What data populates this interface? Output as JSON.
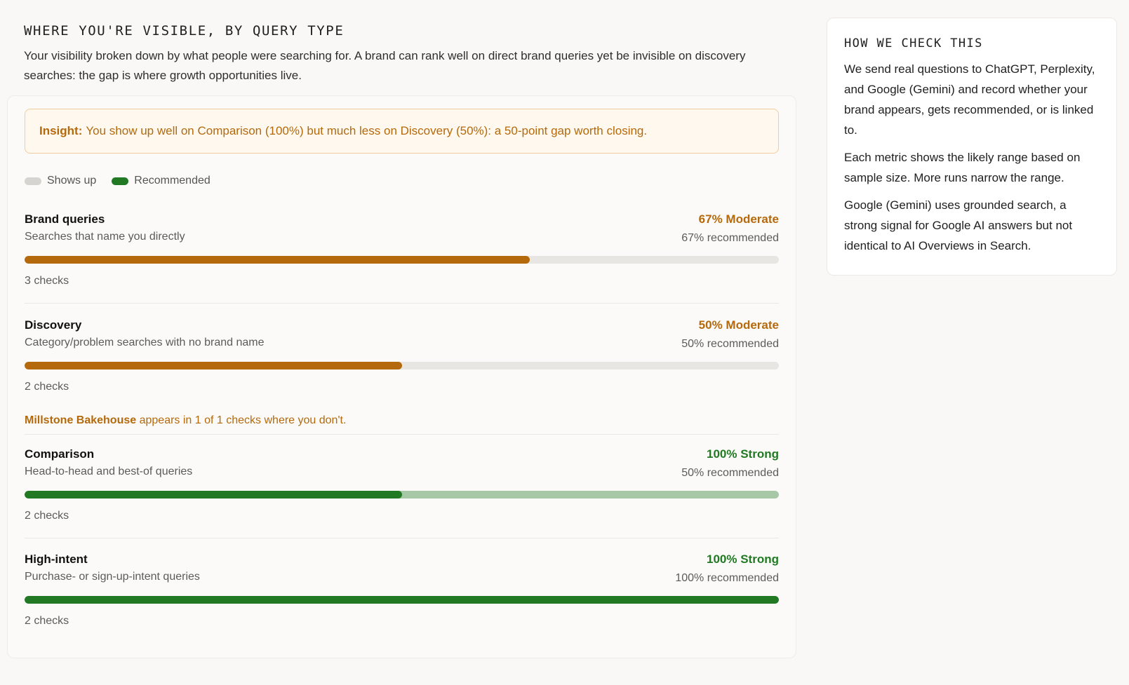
{
  "header": {
    "title": "WHERE YOU'RE VISIBLE, BY QUERY TYPE",
    "description": "Your visibility broken down by what people were searching for. A brand can rank well on direct brand queries yet be invisible on discovery searches: the gap is where growth opportunities live."
  },
  "insight": {
    "label": "Insight:",
    "text": "You show up well on Comparison (100%) but much less on Discovery (50%): a 50-point gap worth closing."
  },
  "legend": {
    "shows_up": "Shows up",
    "recommended": "Recommended"
  },
  "colors": {
    "moderate": "#b46a0c",
    "strong": "#217a23",
    "strong_light": "#a6c8a6",
    "track": "#e8e6e3"
  },
  "query_types": [
    {
      "name": "Brand queries",
      "subtitle": "Searches that name you directly",
      "score_label": "67% Moderate",
      "level": "moderate",
      "shows_up_pct": 67,
      "recommended_pct": 67,
      "recommended_label": "67% recommended",
      "checks_label": "3 checks"
    },
    {
      "name": "Discovery",
      "subtitle": "Category/problem searches with no brand name",
      "score_label": "50% Moderate",
      "level": "moderate",
      "shows_up_pct": 50,
      "recommended_pct": 50,
      "recommended_label": "50% recommended",
      "checks_label": "2 checks",
      "competitor": {
        "name": "Millstone Bakehouse",
        "text": "appears in 1 of 1 checks where you don't."
      }
    },
    {
      "name": "Comparison",
      "subtitle": "Head-to-head and best-of queries",
      "score_label": "100% Strong",
      "level": "strong",
      "shows_up_pct": 100,
      "recommended_pct": 50,
      "recommended_label": "50% recommended",
      "checks_label": "2 checks"
    },
    {
      "name": "High-intent",
      "subtitle": "Purchase- or sign-up-intent queries",
      "score_label": "100% Strong",
      "level": "strong",
      "shows_up_pct": 100,
      "recommended_pct": 100,
      "recommended_label": "100% recommended",
      "checks_label": "2 checks"
    }
  ],
  "sidebar": {
    "title": "HOW WE CHECK THIS",
    "paragraphs": [
      "We send real questions to ChatGPT, Perplexity, and Google (Gemini) and record whether your brand appears, gets recommended, or is linked to.",
      "Each metric shows the likely range based on sample size. More runs narrow the range.",
      "Google (Gemini) uses grounded search, a strong signal for Google AI answers but not identical to AI Overviews in Search."
    ]
  }
}
